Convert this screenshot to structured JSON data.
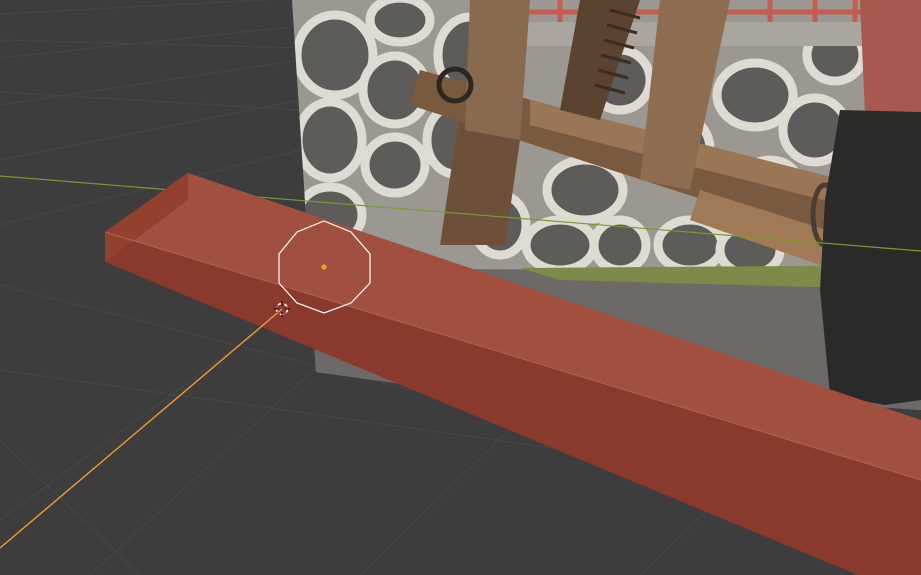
{
  "viewport": {
    "background_color": "#3d3d3d",
    "grid_line_color": "#484848",
    "x_axis_color": "#7a9a2e",
    "selection_line_color": "#f29d2f",
    "origin_dot_color": "#f29d2f",
    "circle_outline_color": "#ffffff",
    "cursor_icon": "3d-cursor-icon"
  },
  "reference_image": {
    "subject": "stone-wall-and-wooden-cart",
    "wall_color": "#9a9890",
    "stone_color": "#5e5c58",
    "mortar_color": "#dedbd3",
    "wood_color": "#7a5a3e",
    "ground_color": "#6c6966",
    "fence_color": "#c45c50"
  },
  "beam": {
    "top_face_color": "#a1503f",
    "front_face_color": "#8a3a2c",
    "end_face_color": "#93412f"
  }
}
